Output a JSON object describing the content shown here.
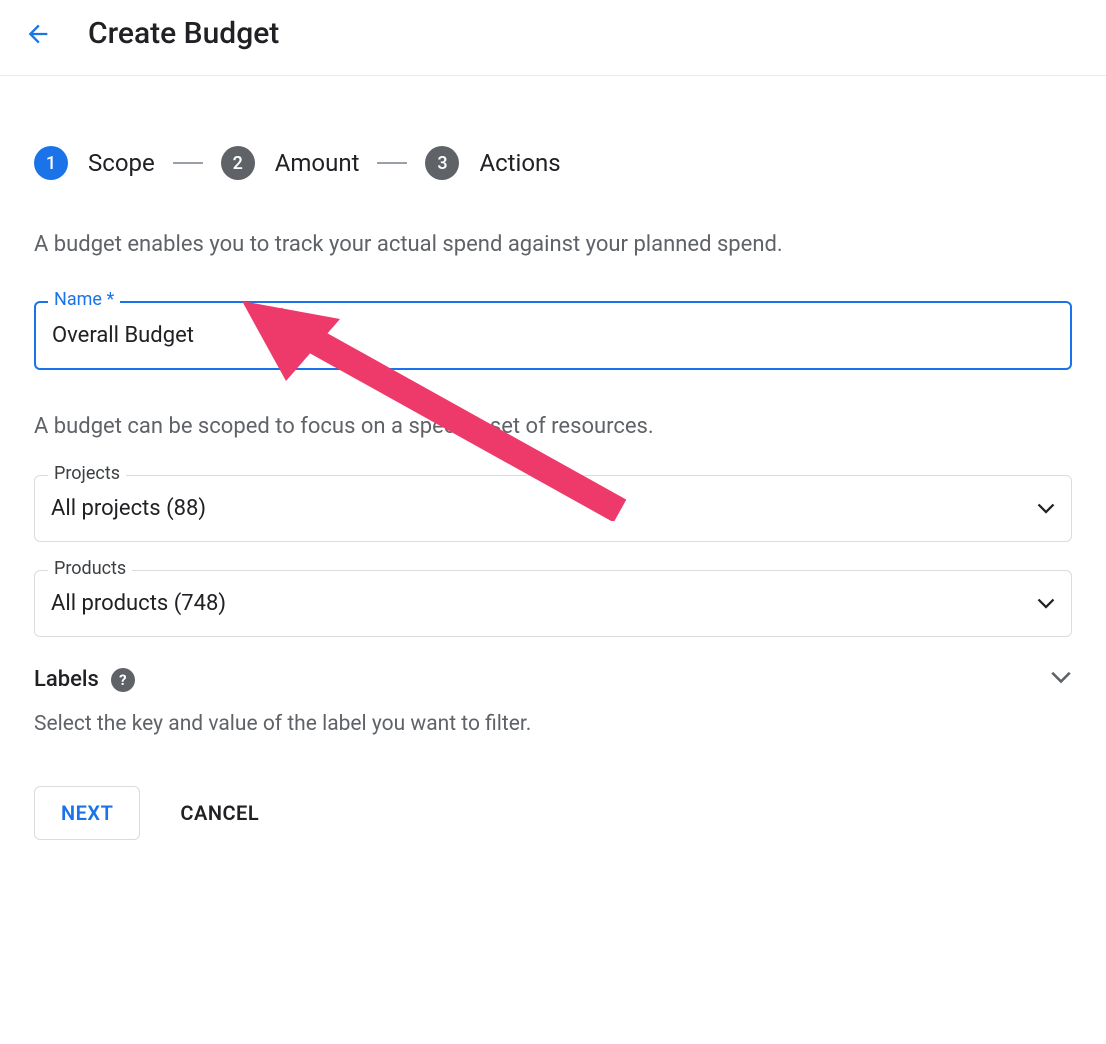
{
  "header": {
    "title": "Create Budget"
  },
  "stepper": {
    "step1": {
      "num": "1",
      "label": "Scope"
    },
    "step2": {
      "num": "2",
      "label": "Amount"
    },
    "step3": {
      "num": "3",
      "label": "Actions"
    }
  },
  "scope": {
    "desc1": "A budget enables you to track your actual spend against your planned spend.",
    "desc2": "A budget can be scoped to focus on a specific set of resources.",
    "name_label": "Name",
    "name_required": "*",
    "name_value": "Overall Budget",
    "projects_label": "Projects",
    "projects_value": "All projects (88)",
    "products_label": "Products",
    "products_value": "All products (748)"
  },
  "labels": {
    "title": "Labels",
    "desc": "Select the key and value of the label you want to filter."
  },
  "buttons": {
    "next": "NEXT",
    "cancel": "CANCEL"
  },
  "colors": {
    "primary": "#1a73e8",
    "annotation": "#ee3a6a"
  }
}
